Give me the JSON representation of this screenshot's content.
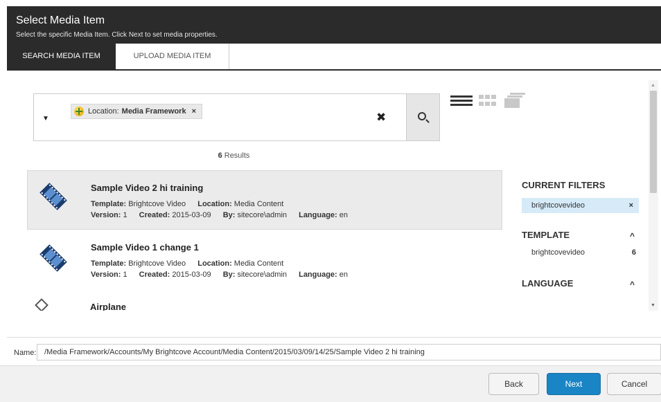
{
  "dialog": {
    "title": "Select Media Item",
    "subtitle": "Select the specific Media Item. Click Next to set media properties."
  },
  "tabs": [
    {
      "label": "SEARCH MEDIA ITEM",
      "active": true
    },
    {
      "label": "UPLOAD MEDIA ITEM",
      "active": false
    }
  ],
  "search": {
    "chip_key": "Location:",
    "chip_value": "Media Framework",
    "chip_remove": "×",
    "clear": "✖"
  },
  "results": {
    "count": "6",
    "count_suffix": "Results",
    "items": [
      {
        "title": "Sample Video 2 hi training",
        "template_label": "Template:",
        "template": "Brightcove Video",
        "location_label": "Location:",
        "location": "Media Content",
        "version_label": "Version:",
        "version": "1",
        "created_label": "Created:",
        "created": "2015-03-09",
        "by_label": "By:",
        "by": "sitecore\\admin",
        "language_label": "Language:",
        "language": "en"
      },
      {
        "title": "Sample Video 1 change 1",
        "template_label": "Template:",
        "template": "Brightcove Video",
        "location_label": "Location:",
        "location": "Media Content",
        "version_label": "Version:",
        "version": "1",
        "created_label": "Created:",
        "created": "2015-03-09",
        "by_label": "By:",
        "by": "sitecore\\admin",
        "language_label": "Language:",
        "language": "en"
      },
      {
        "title": "Airplane"
      }
    ]
  },
  "filters": {
    "current_heading": "CURRENT FILTERS",
    "current_value": "brightcovevideo",
    "current_remove": "×",
    "template_heading": "TEMPLATE",
    "template_value": "brightcovevideo",
    "template_count": "6",
    "language_heading": "LANGUAGE",
    "caret": "^"
  },
  "name": {
    "label": "Name:",
    "value": "/Media Framework/Accounts/My Brightcove Account/Media Content/2015/03/09/14/25/Sample Video 2 hi training"
  },
  "buttons": {
    "back": "Back",
    "next": "Next",
    "cancel": "Cancel"
  },
  "colors": {
    "header_bg": "#2b2b2b",
    "primary_button": "#1a85c5",
    "filter_highlight": "#d6eaf8"
  },
  "icons": {
    "list_view": "list-view-icon",
    "grid_view": "grid-view-icon",
    "stack_view": "stack-view-icon",
    "search": "search-icon",
    "video": "film-strip-icon"
  }
}
